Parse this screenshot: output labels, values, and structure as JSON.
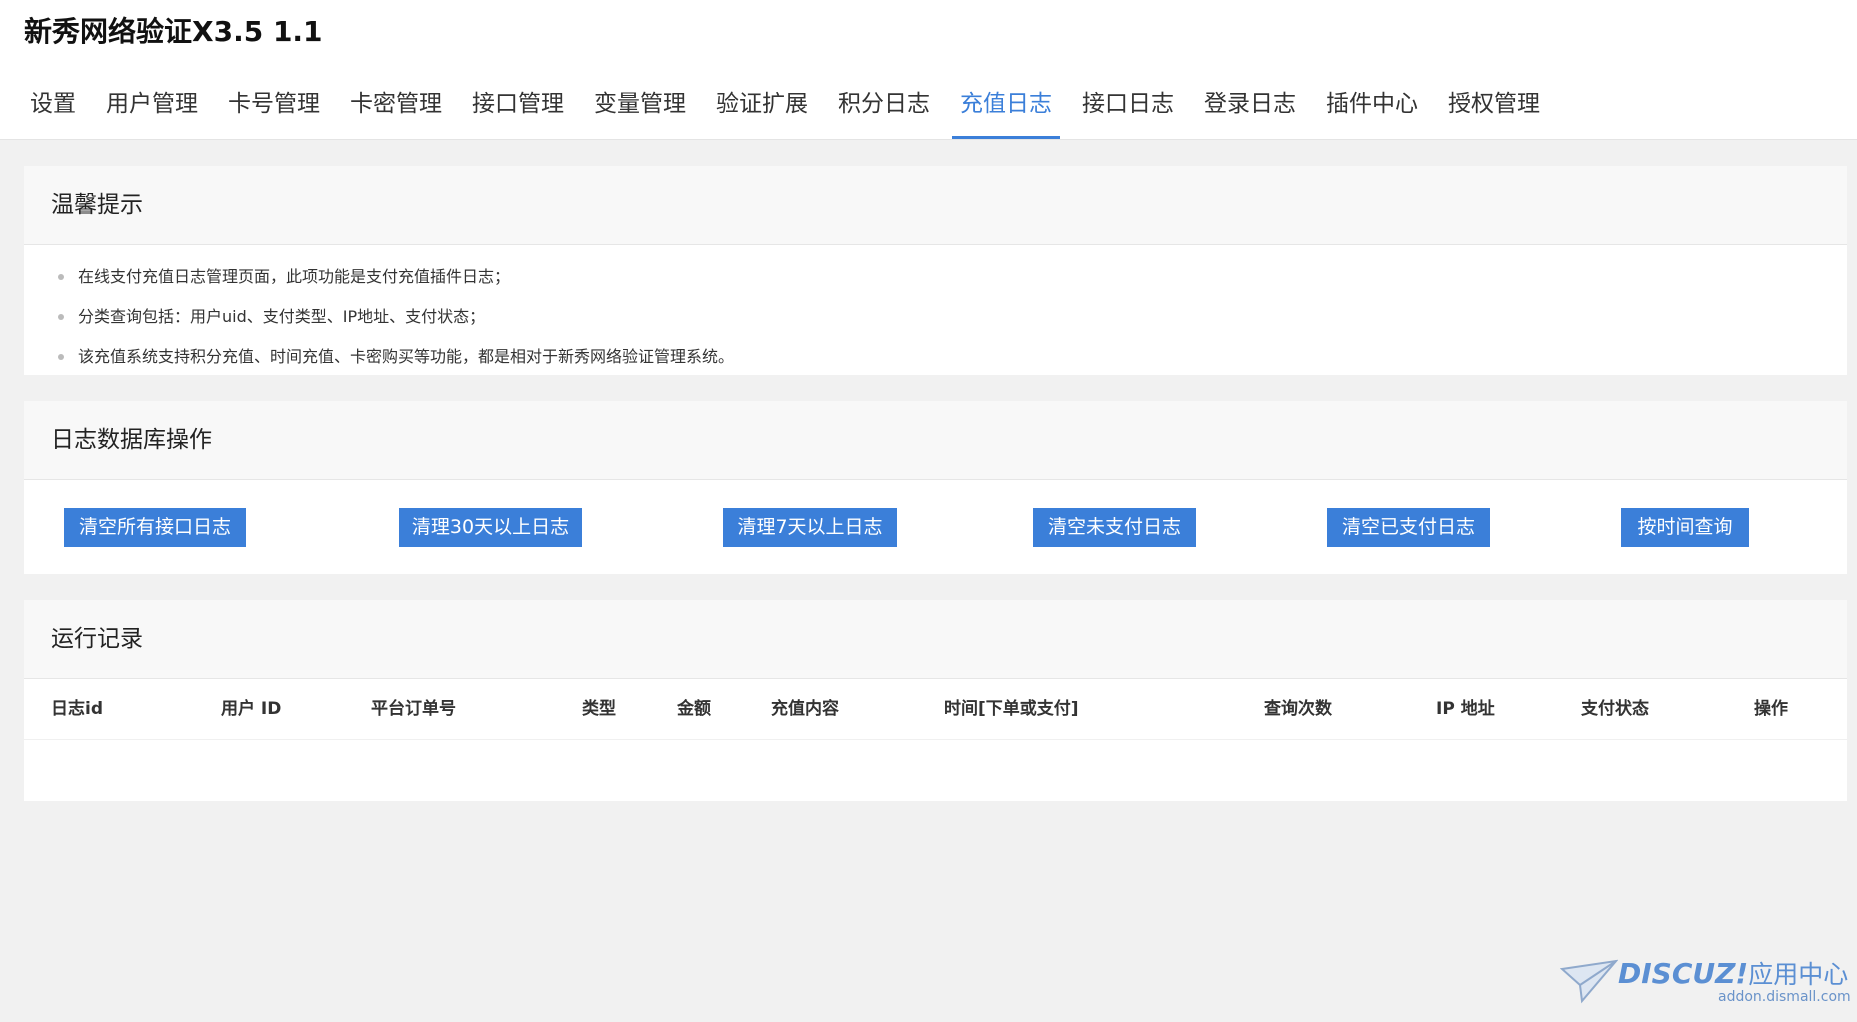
{
  "app": {
    "title": "新秀网络验证X3.5 1.1"
  },
  "nav": {
    "tabs": [
      {
        "label": "设置"
      },
      {
        "label": "用户管理"
      },
      {
        "label": "卡号管理"
      },
      {
        "label": "卡密管理"
      },
      {
        "label": "接口管理"
      },
      {
        "label": "变量管理"
      },
      {
        "label": "验证扩展"
      },
      {
        "label": "积分日志"
      },
      {
        "label": "充值日志"
      },
      {
        "label": "接口日志"
      },
      {
        "label": "登录日志"
      },
      {
        "label": "插件中心"
      },
      {
        "label": "授权管理"
      }
    ],
    "active_index": 8
  },
  "tips": {
    "title": "温馨提示",
    "items": [
      "在线支付充值日志管理页面，此项功能是支付充值插件日志；",
      "分类查询包括：用户uid、支付类型、IP地址、支付状态；",
      "该充值系统支持积分充值、时间充值、卡密购买等功能，都是相对于新秀网络验证管理系统。"
    ]
  },
  "ops": {
    "title": "日志数据库操作",
    "buttons": [
      "清空所有接口日志",
      "清理30天以上日志",
      "清理7天以上日志",
      "清空未支付日志",
      "清空已支付日志",
      "按时间查询"
    ]
  },
  "log": {
    "title": "运行记录",
    "columns": [
      "日志id",
      "用户 ID",
      "平台订单号",
      "类型",
      "金额",
      "充值内容",
      "时间[下单或支付]",
      "查询次数",
      "IP 地址",
      "支付状态",
      "操作"
    ]
  },
  "watermark": {
    "brand": "DISCUZ!",
    "brand_cn": "应用中心",
    "url": "addon.dismall.com"
  },
  "colors": {
    "accent": "#3b7fd9",
    "background": "#f1f1f1"
  }
}
